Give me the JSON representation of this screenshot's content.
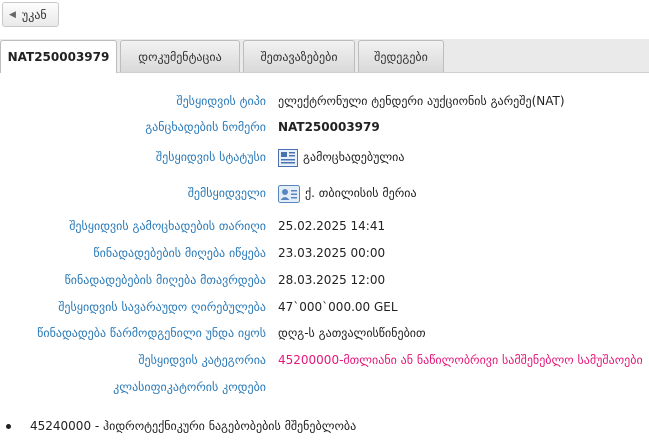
{
  "back_button": {
    "label": "უკან",
    "icon": "triangle-left-icon"
  },
  "tabs": [
    {
      "label": "NAT250003979",
      "active": true
    },
    {
      "label": "დოკუმენტაცია",
      "active": false
    },
    {
      "label": "შეთავაზებები",
      "active": false
    },
    {
      "label": "შედეგები",
      "active": false
    }
  ],
  "fields": {
    "procurement_type": {
      "label": "შესყიდვის ტიპი",
      "value": "ელექტრონული ტენდერი აუქციონის გარეშე(NAT)"
    },
    "announcement_number": {
      "label": "განცხადების ნომერი",
      "value": "NAT250003979"
    },
    "status": {
      "label": "შესყიდვის სტატუსი",
      "value": "გამოცხადებულია",
      "icon": "newspaper-icon"
    },
    "buyer": {
      "label": "შემსყიდველი",
      "value": "ქ. თბილისის მერია",
      "icon": "id-card-icon"
    },
    "announce_date": {
      "label": "შესყიდვის გამოცხადების თარიღი",
      "value": "25.02.2025 14:41"
    },
    "bids_start": {
      "label": "წინადადებების მიღება იწყება",
      "value": "23.03.2025 00:00"
    },
    "bids_end": {
      "label": "წინადადებების მიღება მთავრდება",
      "value": "28.03.2025 12:00"
    },
    "estimated_value": {
      "label": "შესყიდვის სავარაუდო ღირებულება",
      "value": "47`000`000.00 GEL"
    },
    "bid_presentation": {
      "label": "წინადადება წარმოდგენილი უნდა იყოს",
      "value": "დღგ-ს გათვალისწინებით"
    },
    "category": {
      "label": "შესყიდვის კატეგორია",
      "value": "45200000-მთლიანი ან ნაწილობრივი სამშენებლო სამუშაოები"
    },
    "classifier_codes": {
      "label": "კლასიფიკატორის კოდები",
      "value": ""
    }
  },
  "classifier_list": [
    "45240000 - ჰიდროტექნიკური ნაგებობების მშენებლობა"
  ],
  "colors": {
    "label_blue": "#2a7ab8",
    "category_pink": "#e4177a"
  }
}
